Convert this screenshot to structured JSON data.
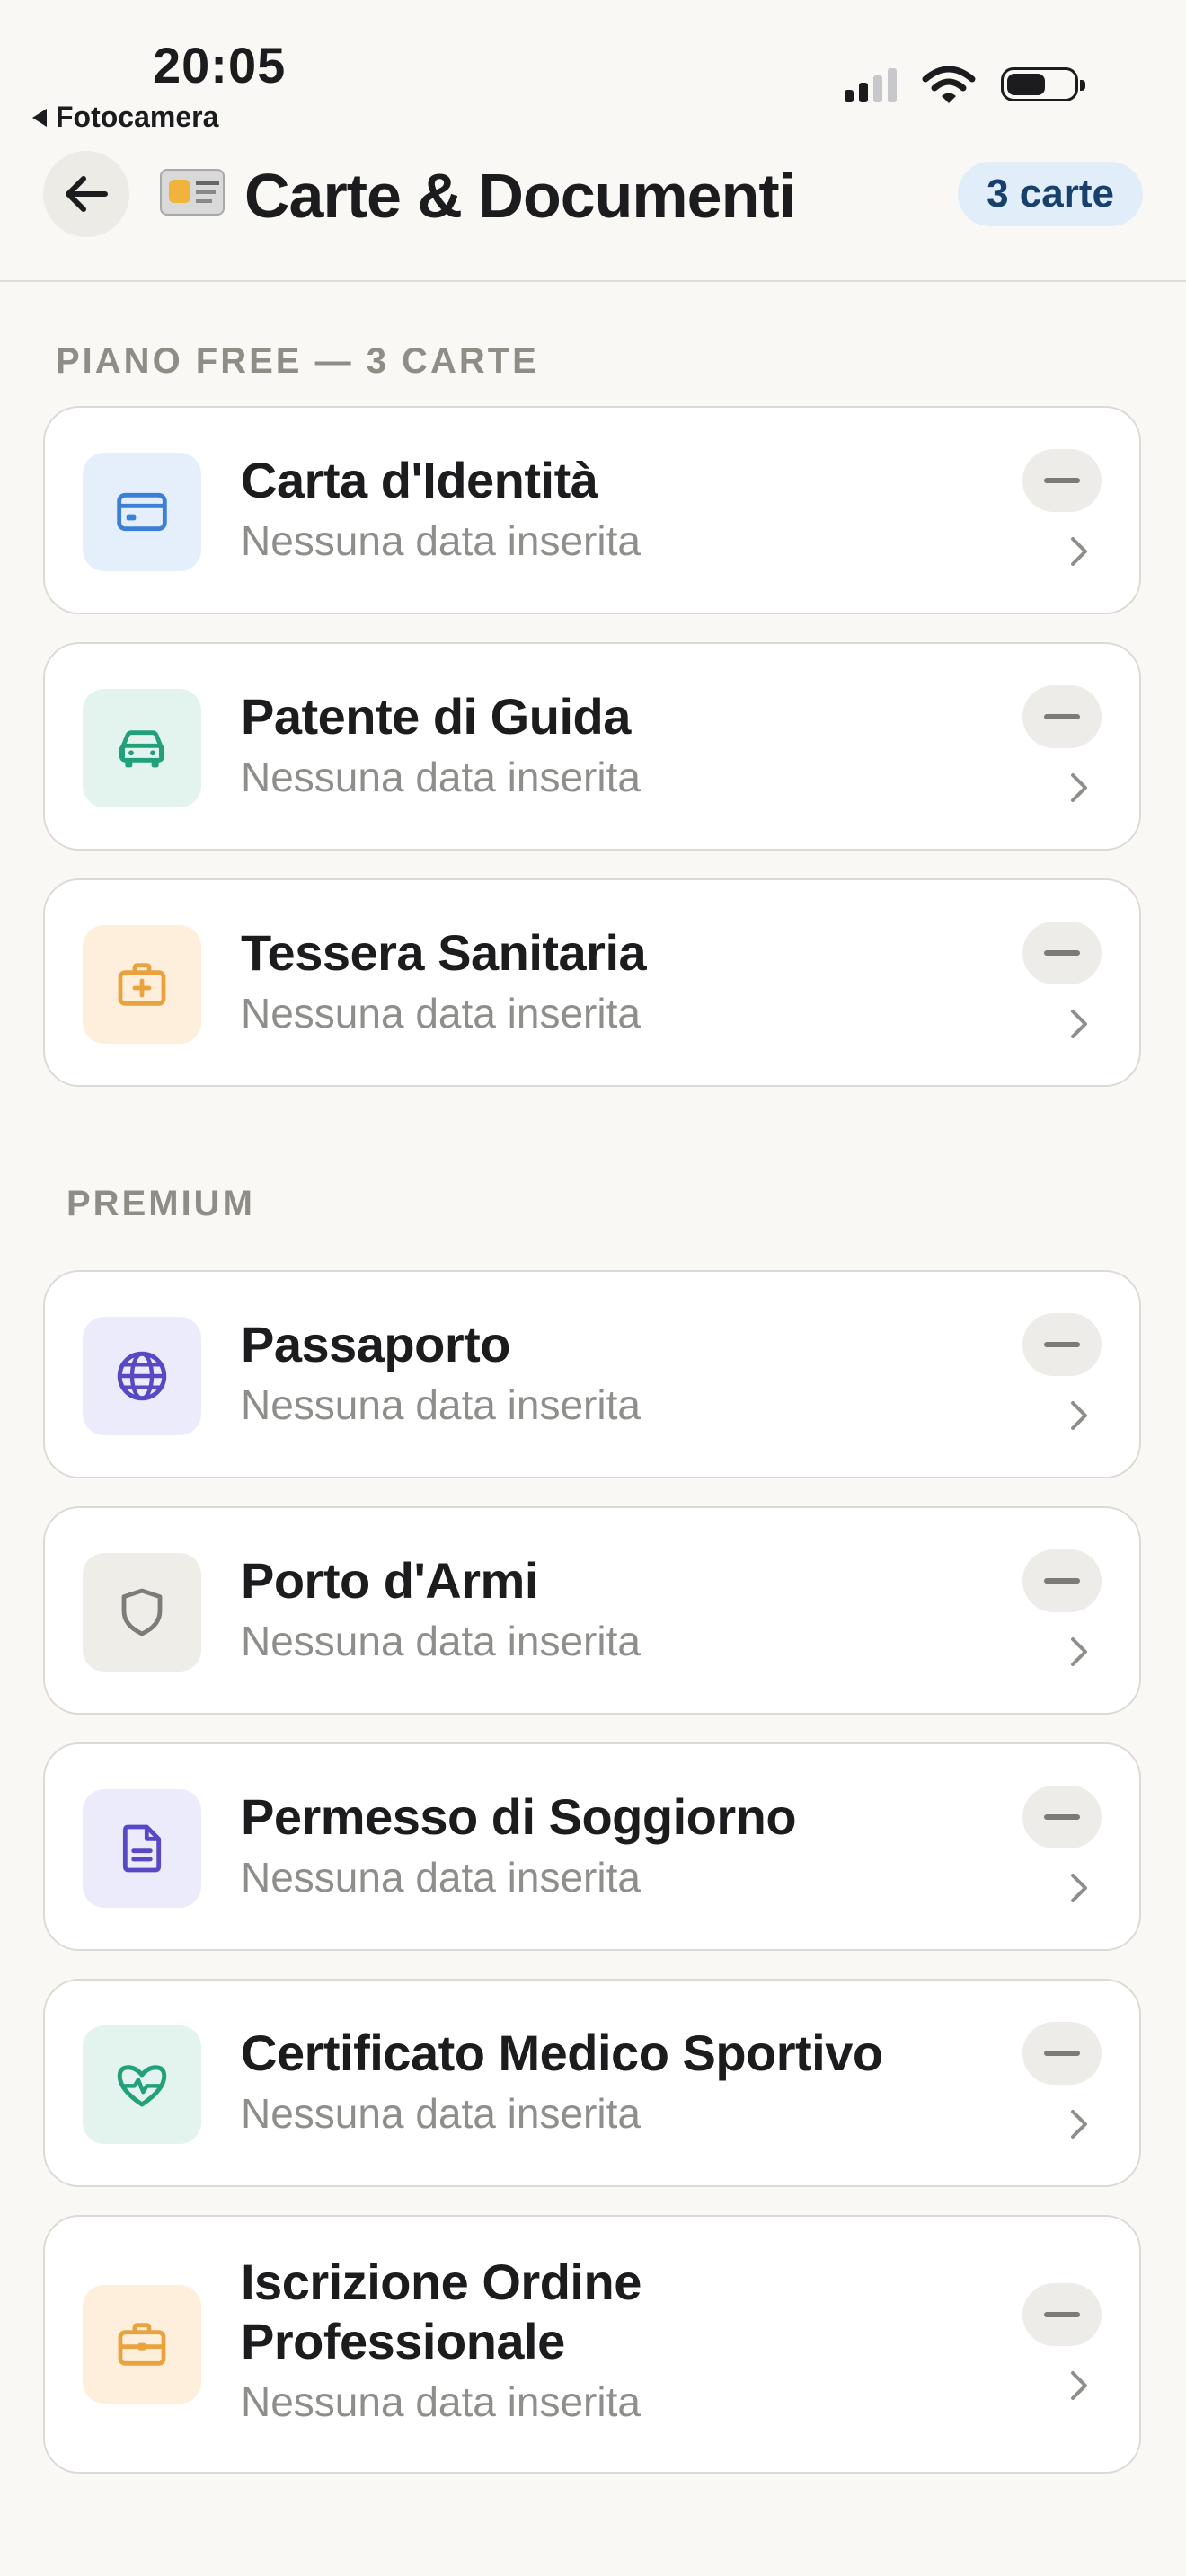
{
  "status": {
    "time": "20:05",
    "back_app": "Fotocamera"
  },
  "header": {
    "title": "Carte & Documenti",
    "badge": "3 carte"
  },
  "sections": {
    "free": "PIANO FREE — 3 CARTE",
    "premium": "PREMIUM"
  },
  "cards": [
    {
      "title": "Carta d'Identità",
      "subtitle": "Nessuna data inserita",
      "icon": "credit-card-icon",
      "tint": "#e4effb",
      "color": "#3b7fd6"
    },
    {
      "title": "Patente di Guida",
      "subtitle": "Nessuna data inserita",
      "icon": "car-icon",
      "tint": "#e2f4ed",
      "color": "#22a07a"
    },
    {
      "title": "Tessera Sanitaria",
      "subtitle": "Nessuna data inserita",
      "icon": "medical-kit-icon",
      "tint": "#fdefdc",
      "color": "#eaa33c"
    },
    {
      "title": "Passaporto",
      "subtitle": "Nessuna data inserita",
      "icon": "globe-icon",
      "tint": "#ecebfb",
      "color": "#5749c4"
    },
    {
      "title": "Porto d'Armi",
      "subtitle": "Nessuna data inserita",
      "icon": "shield-icon",
      "tint": "#efede8",
      "color": "#7c7c79"
    },
    {
      "title": "Permesso di Soggiorno",
      "subtitle": "Nessuna data inserita",
      "icon": "document-icon",
      "tint": "#ecebfb",
      "color": "#5749c4"
    },
    {
      "title": "Certificato Medico Sportivo",
      "subtitle": "Nessuna data inserita",
      "icon": "heart-pulse-icon",
      "tint": "#e2f4ed",
      "color": "#22a07a"
    },
    {
      "title": "Iscrizione Ordine Professionale",
      "subtitle": "Nessuna data inserita",
      "icon": "briefcase-icon",
      "tint": "#fdefdc",
      "color": "#eaa33c"
    }
  ]
}
